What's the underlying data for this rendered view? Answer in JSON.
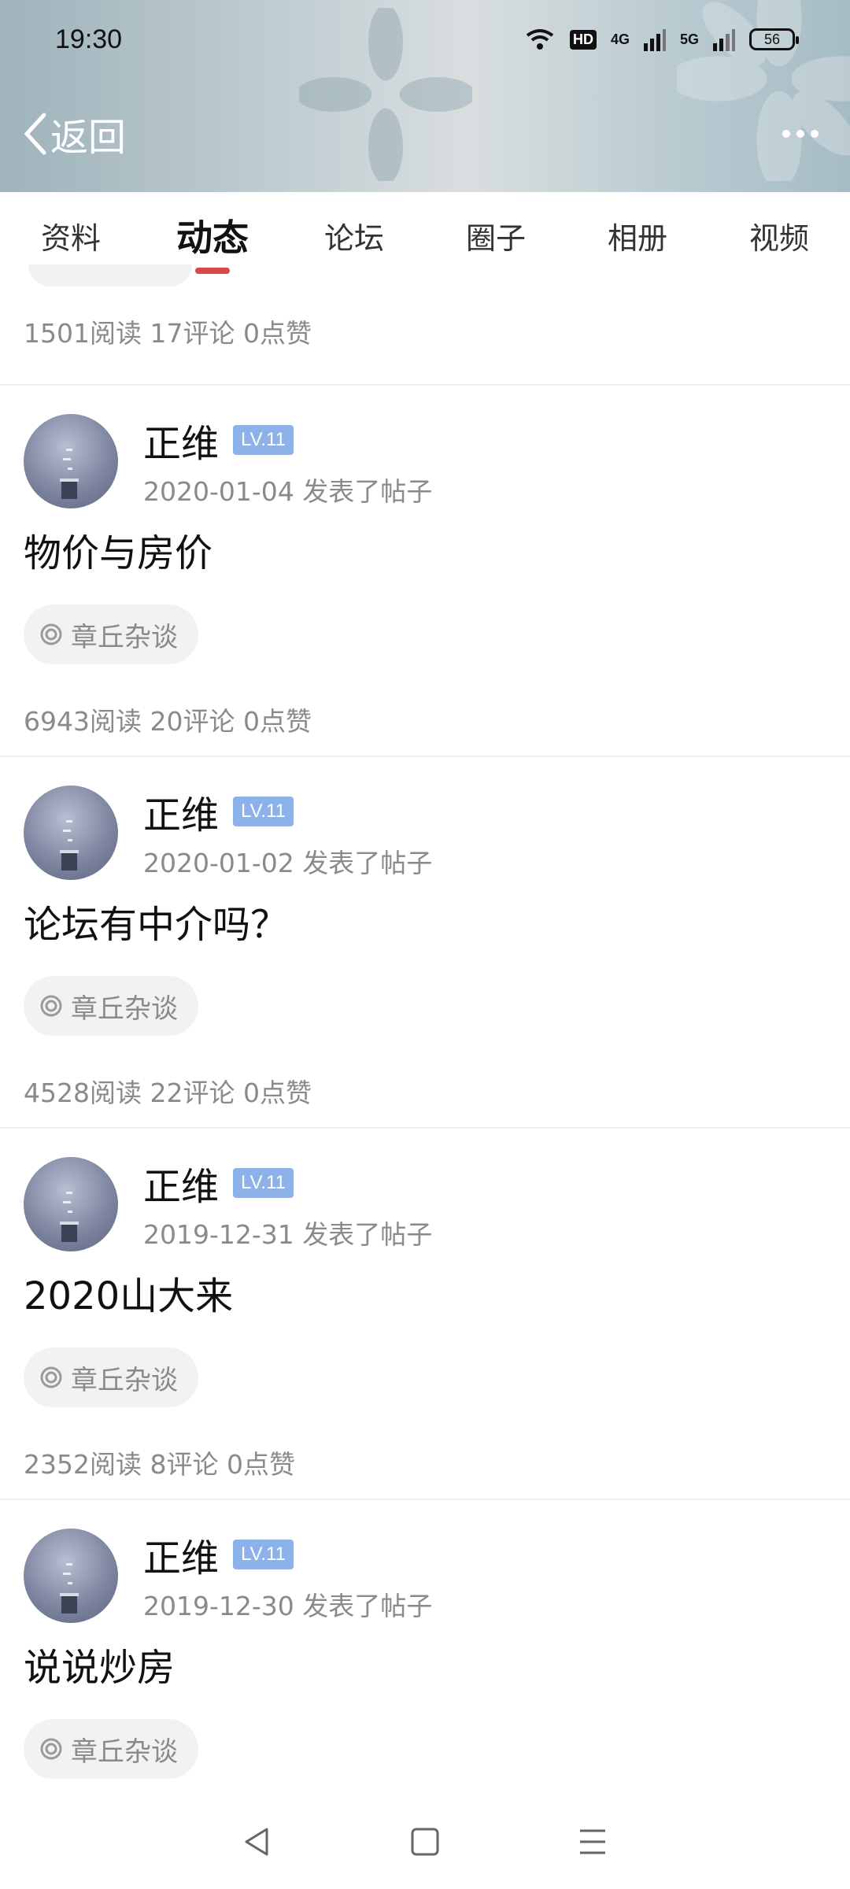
{
  "status_bar": {
    "time": "19:30",
    "hd_label": "HD",
    "net1": "4G",
    "net2": "5G",
    "battery": "56"
  },
  "nav": {
    "back_label": "返回"
  },
  "tabs": [
    {
      "label": "资料",
      "active": false
    },
    {
      "label": "动态",
      "active": true
    },
    {
      "label": "论坛",
      "active": false
    },
    {
      "label": "圈子",
      "active": false
    },
    {
      "label": "相册",
      "active": false
    },
    {
      "label": "视频",
      "active": false
    }
  ],
  "feed": {
    "first_stats": "1501阅读 17评论 0点赞",
    "posts": [
      {
        "author": "正维",
        "level": "LV.11",
        "date": "2020-01-04",
        "action": "发表了帖子",
        "title": "物价与房价",
        "forum": "章丘杂谈",
        "stats": "6943阅读 20评论 0点赞"
      },
      {
        "author": "正维",
        "level": "LV.11",
        "date": "2020-01-02",
        "action": "发表了帖子",
        "title": "论坛有中介吗？",
        "forum": "章丘杂谈",
        "stats": "4528阅读 22评论 0点赞"
      },
      {
        "author": "正维",
        "level": "LV.11",
        "date": "2019-12-31",
        "action": "发表了帖子",
        "title": "2020山大来",
        "forum": "章丘杂谈",
        "stats": "2352阅读 8评论 0点赞"
      },
      {
        "author": "正维",
        "level": "LV.11",
        "date": "2019-12-30",
        "action": "发表了帖子",
        "title": "说说炒房",
        "forum": "章丘杂谈",
        "stats": ""
      }
    ]
  },
  "colors": {
    "accent_underline": "#d84a4a",
    "level_badge": "#8db2ea",
    "muted_text": "#8a8a8a"
  }
}
